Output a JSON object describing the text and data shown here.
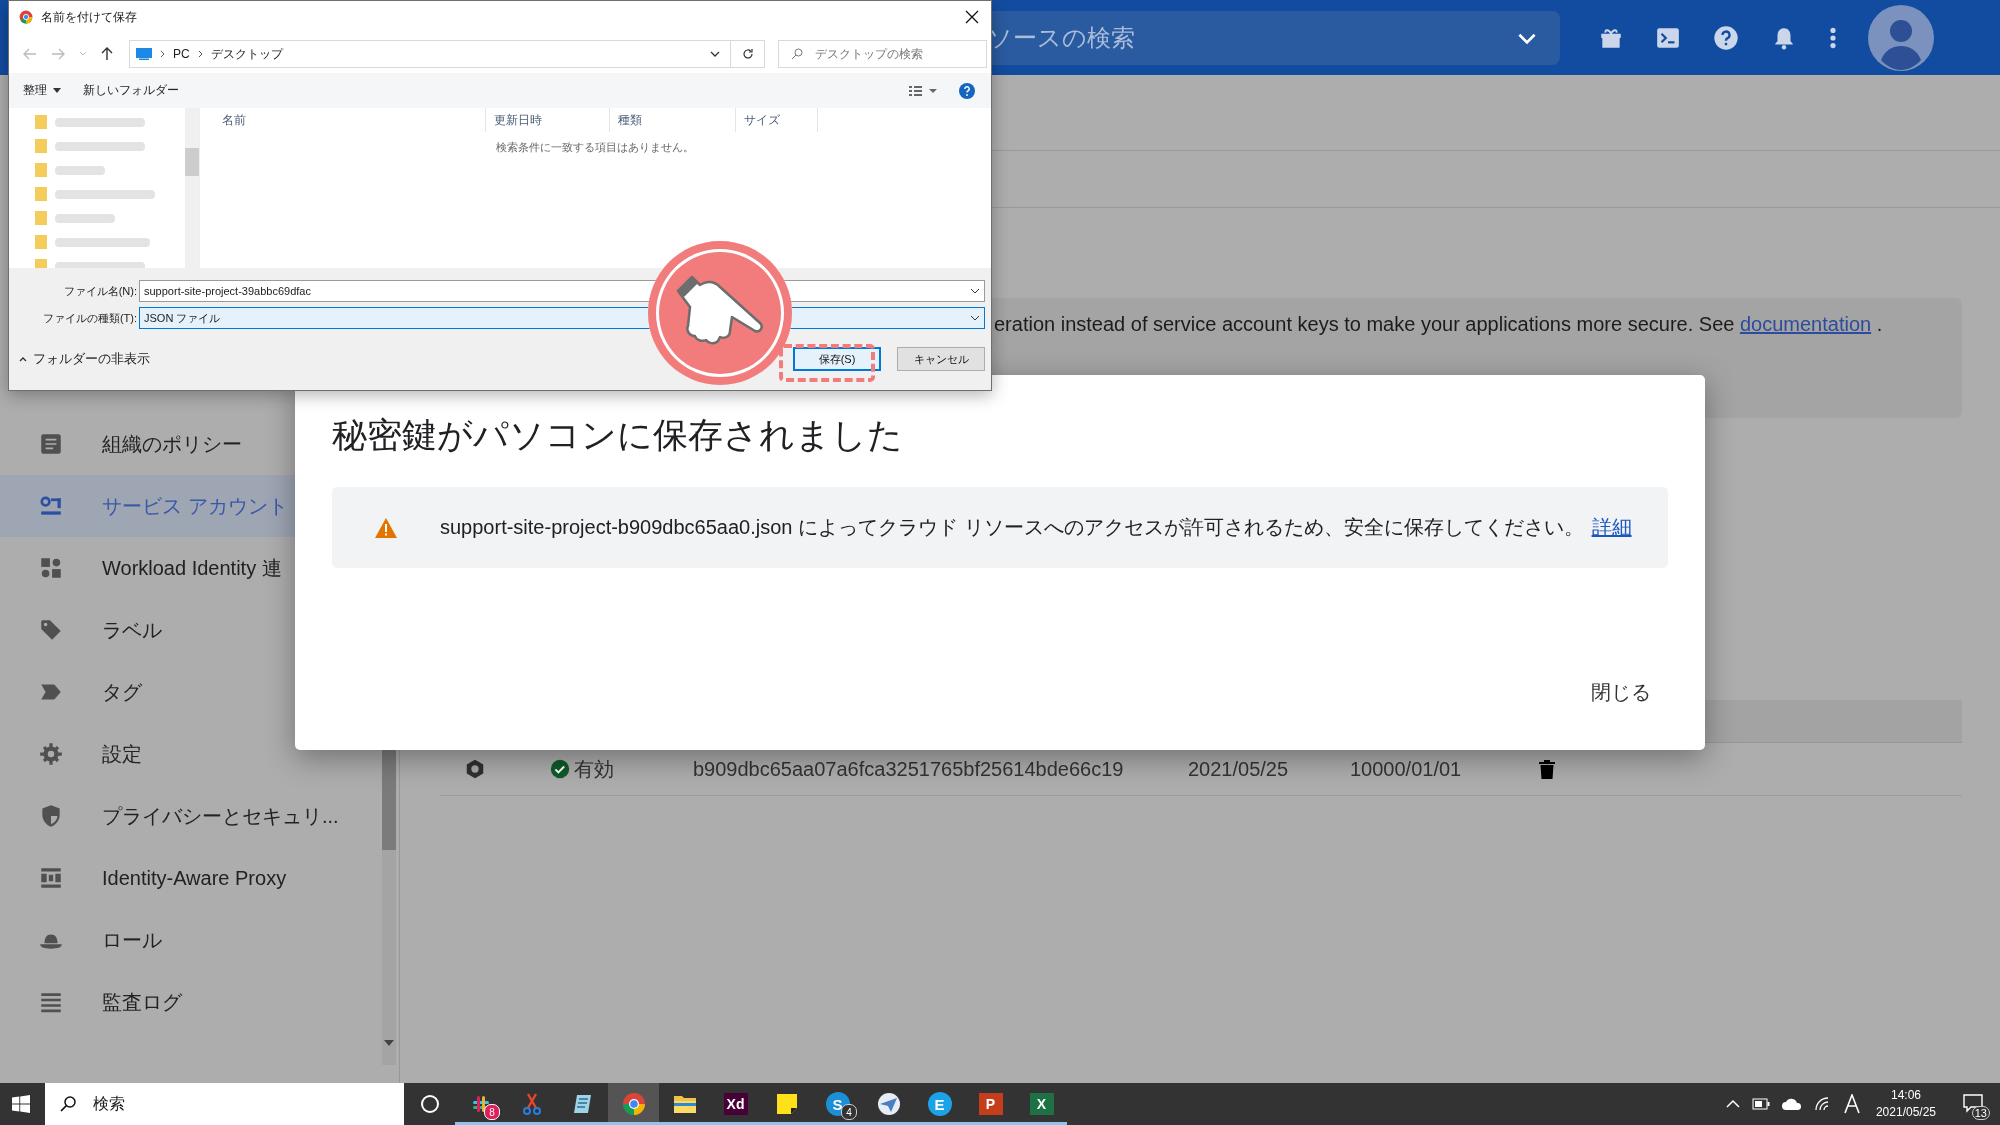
{
  "header": {
    "search": {
      "placeholder": "ソースの検索"
    }
  },
  "sidebar": {
    "items": [
      {
        "label": "組織のポリシー",
        "kind": "policy",
        "selected": false
      },
      {
        "label": "サービス アカウント",
        "kind": "account",
        "selected": true
      },
      {
        "label": "Workload Identity 連",
        "kind": "workload",
        "selected": false
      },
      {
        "label": "ラベル",
        "kind": "label",
        "selected": false
      },
      {
        "label": "タグ",
        "kind": "tag",
        "selected": false
      },
      {
        "label": "設定",
        "kind": "settings",
        "selected": false
      },
      {
        "label": "プライバシーとセキュリ...",
        "kind": "shield",
        "selected": false
      },
      {
        "label": "Identity-Aware Proxy",
        "kind": "proxy",
        "selected": false
      },
      {
        "label": "ロール",
        "kind": "role",
        "selected": false
      },
      {
        "label": "監査ログ",
        "kind": "log",
        "selected": false
      }
    ]
  },
  "banner": {
    "text": "eration instead of service account keys to make your applications more secure. See",
    "link": "documentation",
    "end": "."
  },
  "keys_table": {
    "rows": [
      {
        "status": "有効",
        "key_id": "b909dbc65aa07a6fca3251765bf25614bde66c19",
        "created": "2021/05/25",
        "expires": "10000/01/01"
      }
    ]
  },
  "modal": {
    "title": "秘密鍵がパソコンに保存されました",
    "alert": "support-site-project-b909dbc65aa0.json によってクラウド リソースへのアクセスが許可されるため、安全に保存してください。",
    "link": "詳細",
    "close_button": "閉じる"
  },
  "save_dialog": {
    "title": "名前を付けて保存",
    "path": [
      "PC",
      "デスクトップ"
    ],
    "search_placeholder": "デスクトップの検索",
    "organize": "整理",
    "new_folder": "新しいフォルダー",
    "columns": [
      "名前",
      "更新日時",
      "種類",
      "サイズ"
    ],
    "empty_message": "検索条件に一致する項目はありません。",
    "file_name_label": "ファイル名(N):",
    "file_name": "support-site-project-39abbc69dfac",
    "file_type_label": "ファイルの種類(T):",
    "file_type": "JSON ファイル",
    "hide_folders": "フォルダーの非表示",
    "save_button": "保存(S)",
    "cancel_button": "キャンセル"
  },
  "taskbar": {
    "search_placeholder": "検索",
    "apps": [
      {
        "kind": "cortana",
        "running": false,
        "selected": false
      },
      {
        "kind": "slack",
        "running": true,
        "selected": false,
        "badge": "8"
      },
      {
        "kind": "snip",
        "running": true,
        "selected": false
      },
      {
        "kind": "notepad",
        "running": true,
        "selected": false
      },
      {
        "kind": "chrome",
        "running": true,
        "selected": true
      },
      {
        "kind": "folder",
        "running": true,
        "selected": false
      },
      {
        "kind": "letter",
        "label": "Xd",
        "color": "#470137",
        "running": true,
        "selected": false
      },
      {
        "kind": "sticky",
        "running": true,
        "selected": false
      },
      {
        "kind": "round",
        "label": "S",
        "color": "#1d8fd6",
        "running": true,
        "selected": false,
        "badge": "4"
      },
      {
        "kind": "plane",
        "running": true,
        "selected": false
      },
      {
        "kind": "round",
        "label": "E",
        "color": "#1ba3e8",
        "running": true,
        "selected": false
      },
      {
        "kind": "letter",
        "label": "P",
        "color": "#c43e1c",
        "running": true,
        "selected": false
      },
      {
        "kind": "letter",
        "label": "X",
        "color": "#1e7145",
        "running": true,
        "selected": false
      }
    ],
    "time": "14:06",
    "date": "2021/05/25",
    "notifications": "13"
  }
}
